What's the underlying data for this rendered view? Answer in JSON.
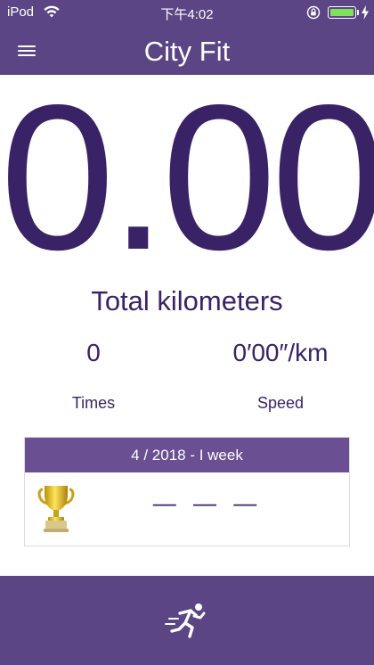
{
  "status_bar": {
    "carrier": "iPod",
    "time": "下午4:02",
    "battery_color": "#7ee35a"
  },
  "navbar": {
    "title": "City Fit",
    "menu_icon": "hamburger-menu-icon"
  },
  "summary": {
    "total_value": "0.00",
    "total_label": "Total kilometers",
    "times_value": "0",
    "times_label": "Times",
    "speed_value": "0′00″/km",
    "speed_label": "Speed"
  },
  "ranking_card": {
    "header": "4 / 2018 - I week",
    "trophy_icon": "trophy-icon",
    "placeholder": "— — —"
  },
  "bottom_bar": {
    "action_icon": "running-person-icon"
  },
  "colors": {
    "brand_purple": "#5c4585",
    "card_header_purple": "#6a4f92",
    "text_dark_purple": "#3a2266"
  }
}
